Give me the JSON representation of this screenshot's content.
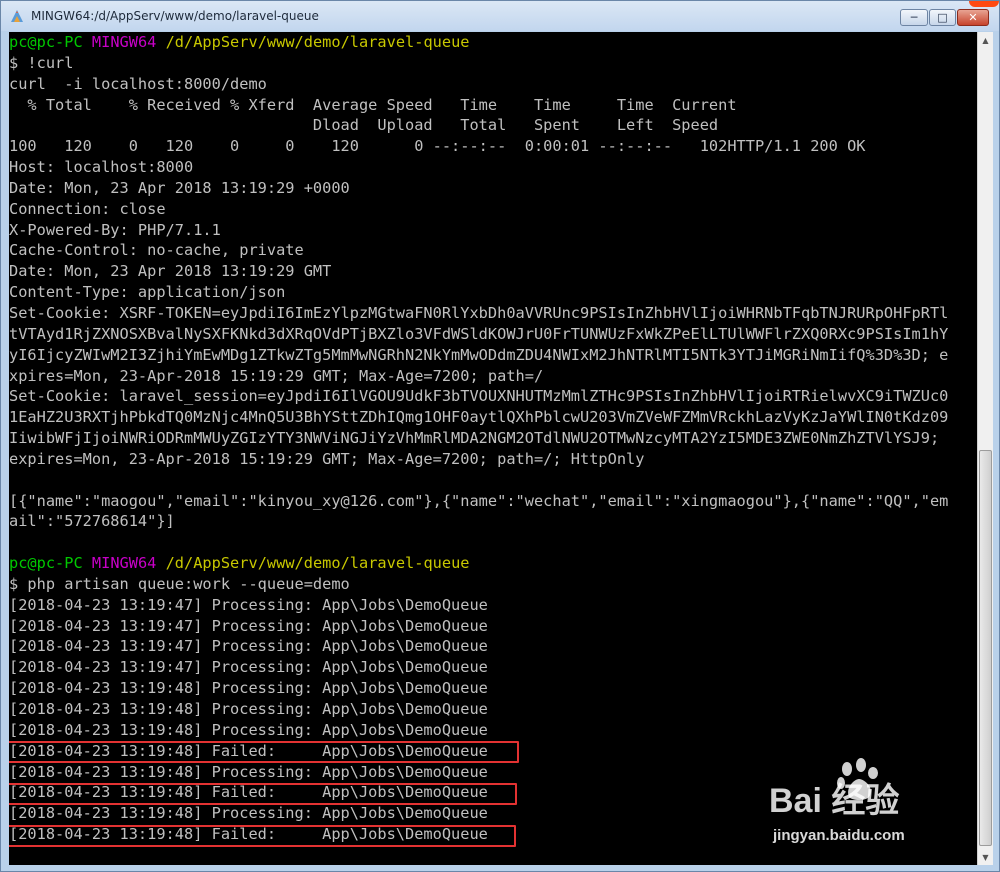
{
  "window": {
    "title": "MINGW64:/d/AppServ/www/demo/laravel-queue",
    "minimize_label": "─",
    "maximize_label": "□",
    "close_label": "✕"
  },
  "terminal": {
    "lines": [
      [
        {
          "t": "pc@pc-PC",
          "c": "green"
        },
        {
          "t": " "
        },
        {
          "t": "MINGW64",
          "c": "magenta"
        },
        {
          "t": " "
        },
        {
          "t": "/d/AppServ/www/demo/laravel-queue",
          "c": "yellow"
        }
      ],
      [
        {
          "t": "$ !curl"
        }
      ],
      [
        {
          "t": "curl  -i localhost:8000/demo"
        }
      ],
      [
        {
          "t": "  % Total    % Received % Xferd  Average Speed   Time    Time     Time  Current"
        }
      ],
      [
        {
          "t": "                                 Dload  Upload   Total   Spent    Left  Speed"
        }
      ],
      [
        {
          "t": "100   120    0   120    0     0    120      0 --:--:--  0:00:01 --:--:--   102HTTP/1.1 200 OK"
        }
      ],
      [
        {
          "t": "Host: localhost:8000"
        }
      ],
      [
        {
          "t": "Date: Mon, 23 Apr 2018 13:19:29 +0000"
        }
      ],
      [
        {
          "t": "Connection: close"
        }
      ],
      [
        {
          "t": "X-Powered-By: PHP/7.1.1"
        }
      ],
      [
        {
          "t": "Cache-Control: no-cache, private"
        }
      ],
      [
        {
          "t": "Date: Mon, 23 Apr 2018 13:19:29 GMT"
        }
      ],
      [
        {
          "t": "Content-Type: application/json"
        }
      ],
      [
        {
          "t": "Set-Cookie: XSRF-TOKEN=eyJpdiI6ImEzYlpzMGtwaFN0RlYxbDh0aVVRUnc9PSIsInZhbHVlIjoiWHRNbTFqbTNJRURpOHFpRTl"
        }
      ],
      [
        {
          "t": "tVTAyd1RjZXNOSXBvalNySXFKNkd3dXRqOVdPTjBXZlo3VFdWSldKOWJrU0FrTUNWUzFxWkZPeElLTUlWWFlrZXQ0RXc9PSIsIm1hY"
        }
      ],
      [
        {
          "t": "yI6IjcyZWIwM2I3ZjhiYmEwMDg1ZTkwZTg5MmMwNGRhN2NkYmMwODdmZDU4NWIxM2JhNTRlMTI5NTk3YTJiMGRiNmIifQ%3D%3D; e"
        }
      ],
      [
        {
          "t": "xpires=Mon, 23-Apr-2018 15:19:29 GMT; Max-Age=7200; path=/"
        }
      ],
      [
        {
          "t": "Set-Cookie: laravel_session=eyJpdiI6IlVGOU9UdkF3bTVOUXNHUTMzMmlZTHc9PSIsInZhbHVlIjoiRTRielwvXC9iTWZUc0"
        }
      ],
      [
        {
          "t": "1EaHZ2U3RXTjhPbkdTQ0MzNjc4MnQ5U3BhYSttZDhIQmg1OHF0aytlQXhPblcwU203VmZVeWFZMmVRckhLazVyKzJaYWlIN0tKdz09"
        }
      ],
      [
        {
          "t": "IiwibWFjIjoiNWRiODRmMWUyZGIzYTY3NWViNGJiYzVhMmRlMDA2NGM2OTdlNWU2OTMwNzcyMTA2YzI5MDE3ZWE0NmZhZTVlYSJ9;"
        }
      ],
      [
        {
          "t": "expires=Mon, 23-Apr-2018 15:19:29 GMT; Max-Age=7200; path=/; HttpOnly"
        }
      ],
      [
        {
          "t": ""
        }
      ],
      [
        {
          "t": "[{\"name\":\"maogou\",\"email\":\"kinyou_xy@126.com\"},{\"name\":\"wechat\",\"email\":\"xingmaogou\"},{\"name\":\"QQ\",\"em"
        }
      ],
      [
        {
          "t": "ail\":\"572768614\"}]"
        }
      ],
      [
        {
          "t": ""
        }
      ],
      [
        {
          "t": "pc@pc-PC",
          "c": "green"
        },
        {
          "t": " "
        },
        {
          "t": "MINGW64",
          "c": "magenta"
        },
        {
          "t": " "
        },
        {
          "t": "/d/AppServ/www/demo/laravel-queue",
          "c": "yellow"
        }
      ],
      [
        {
          "t": "$ php artisan queue:work --queue=demo"
        }
      ],
      [
        {
          "t": "[2018-04-23 13:19:47] Processing: App\\Jobs\\DemoQueue"
        }
      ],
      [
        {
          "t": "[2018-04-23 13:19:47] Processing: App\\Jobs\\DemoQueue"
        }
      ],
      [
        {
          "t": "[2018-04-23 13:19:47] Processing: App\\Jobs\\DemoQueue"
        }
      ],
      [
        {
          "t": "[2018-04-23 13:19:47] Processing: App\\Jobs\\DemoQueue"
        }
      ],
      [
        {
          "t": "[2018-04-23 13:19:48] Processing: App\\Jobs\\DemoQueue"
        }
      ],
      [
        {
          "t": "[2018-04-23 13:19:48] Processing: App\\Jobs\\DemoQueue"
        }
      ],
      [
        {
          "t": "[2018-04-23 13:19:48] Processing: App\\Jobs\\DemoQueue"
        }
      ],
      [
        {
          "t": "[2018-04-23 13:19:48] Failed:     App\\Jobs\\DemoQueue"
        }
      ],
      [
        {
          "t": "[2018-04-23 13:19:48] Processing: App\\Jobs\\DemoQueue"
        }
      ],
      [
        {
          "t": "[2018-04-23 13:19:48] Failed:     App\\Jobs\\DemoQueue"
        }
      ],
      [
        {
          "t": "[2018-04-23 13:19:48] Processing: App\\Jobs\\DemoQueue"
        }
      ],
      [
        {
          "t": "[2018-04-23 13:19:48] Failed:     App\\Jobs\\DemoQueue"
        }
      ]
    ],
    "highlighted_line_indices": [
      34,
      36,
      38
    ]
  },
  "watermark": {
    "logo": "Bai  经验",
    "url": "jingyan.baidu.com"
  },
  "colors": {
    "green": "#00c800",
    "magenta": "#c800c8",
    "yellow": "#c8c800",
    "highlight": "#e33232"
  }
}
